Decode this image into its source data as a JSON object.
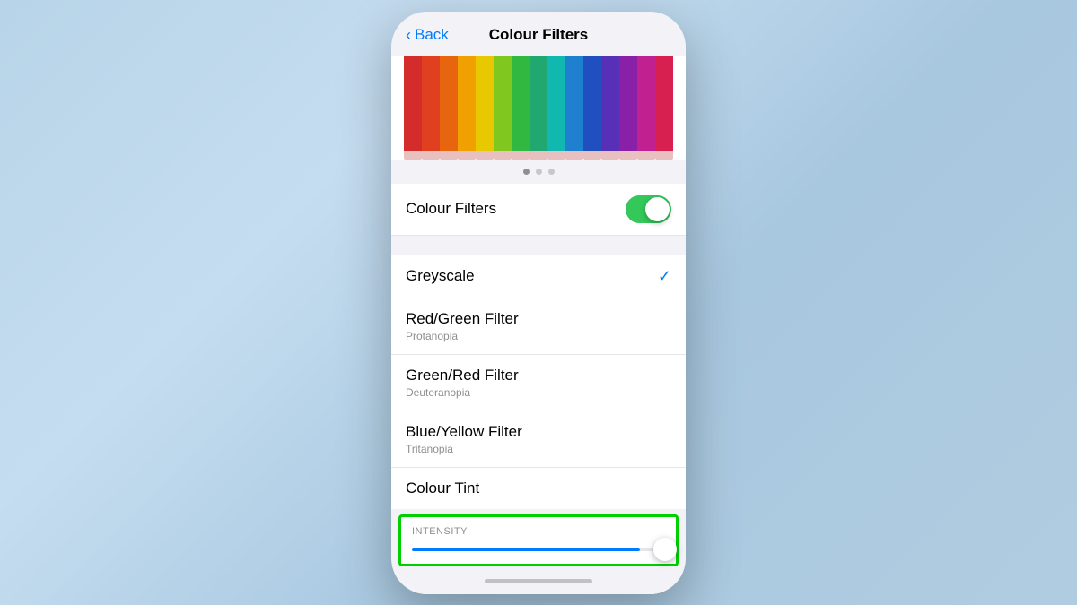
{
  "nav": {
    "back_label": "Back",
    "title": "Colour Filters"
  },
  "page_dots": [
    {
      "active": true
    },
    {
      "active": false
    },
    {
      "active": false
    }
  ],
  "colour_filters_toggle": {
    "label": "Colour Filters",
    "enabled": true
  },
  "filter_options": [
    {
      "label": "Greyscale",
      "sublabel": "",
      "selected": true
    },
    {
      "label": "Red/Green Filter",
      "sublabel": "Protanopia",
      "selected": false
    },
    {
      "label": "Green/Red Filter",
      "sublabel": "Deuteranopia",
      "selected": false
    },
    {
      "label": "Blue/Yellow Filter",
      "sublabel": "Tritanopia",
      "selected": false
    },
    {
      "label": "Colour Tint",
      "sublabel": "",
      "selected": false
    }
  ],
  "intensity": {
    "label": "INTENSITY",
    "value": 90
  },
  "pencils": [
    {
      "color": "#d42b2b",
      "tip": "#b81e1e"
    },
    {
      "color": "#e04020",
      "tip": "#c0321a"
    },
    {
      "color": "#e86510",
      "tip": "#c85008"
    },
    {
      "color": "#f0a000",
      "tip": "#d08800"
    },
    {
      "color": "#e8c800",
      "tip": "#c8a800"
    },
    {
      "color": "#80c820",
      "tip": "#60a810"
    },
    {
      "color": "#30b840",
      "tip": "#20982e"
    },
    {
      "color": "#20a870",
      "tip": "#108858"
    },
    {
      "color": "#10b8b0",
      "tip": "#0898a0"
    },
    {
      "color": "#2080d0",
      "tip": "#1060b0"
    },
    {
      "color": "#2050c0",
      "tip": "#1038a0"
    },
    {
      "color": "#5830b8",
      "tip": "#4020a0"
    },
    {
      "color": "#8820a8",
      "tip": "#701890"
    },
    {
      "color": "#c02090",
      "tip": "#a01878"
    },
    {
      "color": "#d82050",
      "tip": "#b81840"
    }
  ]
}
